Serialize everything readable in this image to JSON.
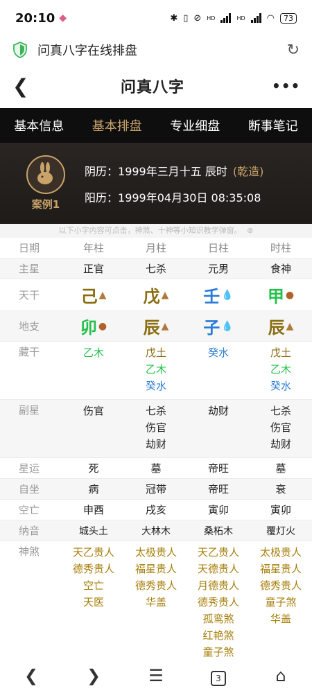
{
  "status": {
    "time": "20:10",
    "battery": "73",
    "hd1": "HD",
    "hd2": "HD"
  },
  "url_bar": {
    "title": "问真八字在线排盘"
  },
  "header": {
    "title": "问真八字",
    "more": "•••"
  },
  "tabs": [
    {
      "label": "基本信息"
    },
    {
      "label": "基本排盘",
      "active": true
    },
    {
      "label": "专业细盘"
    },
    {
      "label": "断事笔记"
    }
  ],
  "profile": {
    "case": "案例1",
    "lunar_label": "阴历：",
    "lunar": "1999年三月十五 辰时",
    "gender_tag": "(乾造)",
    "solar_label": "阳历：",
    "solar": "1999年04月30日 08:35:08"
  },
  "notice": "以下小字内容可点击，神煞、十神等小知识教学弹窗。",
  "grid": {
    "header": {
      "label": "日期",
      "cols": [
        "年柱",
        "月柱",
        "日柱",
        "时柱"
      ]
    },
    "zhuxing": {
      "label": "主星",
      "cols": [
        "正官",
        "七杀",
        "元男",
        "食神"
      ]
    },
    "tiangan": {
      "label": "天干",
      "cols": [
        "己",
        "戊",
        "壬",
        "甲"
      ]
    },
    "dizhi": {
      "label": "地支",
      "cols": [
        "卯",
        "辰",
        "子",
        "辰"
      ]
    },
    "canggan": {
      "label": "藏干",
      "cols": [
        [
          "乙木"
        ],
        [
          "戊土",
          "乙木",
          "癸水"
        ],
        [
          "癸水"
        ],
        [
          "戊土",
          "乙木",
          "癸水"
        ]
      ]
    },
    "fuxing": {
      "label": "副星",
      "cols": [
        [
          "伤官"
        ],
        [
          "七杀",
          "伤官",
          "劫财"
        ],
        [
          "劫财"
        ],
        [
          "七杀",
          "伤官",
          "劫财"
        ]
      ]
    },
    "xingyun": {
      "label": "星运",
      "cols": [
        "死",
        "墓",
        "帝旺",
        "墓"
      ]
    },
    "zizuo": {
      "label": "自坐",
      "cols": [
        "病",
        "冠带",
        "帝旺",
        "衰"
      ]
    },
    "kongwang": {
      "label": "空亡",
      "cols": [
        "申酉",
        "戌亥",
        "寅卯",
        "寅卯"
      ]
    },
    "nayin": {
      "label": "纳音",
      "cols": [
        "城头土",
        "大林木",
        "桑柘木",
        "覆灯火"
      ]
    },
    "shensha": {
      "label": "神煞",
      "cols": [
        [
          "天乙贵人",
          "德秀贵人",
          "空亡",
          "天医"
        ],
        [
          "太极贵人",
          "福星贵人",
          "德秀贵人",
          "华盖"
        ],
        [
          "天乙贵人",
          "天德贵人",
          "月德贵人",
          "德秀贵人",
          "孤鸾煞",
          "红艳煞",
          "童子煞"
        ],
        [
          "太极贵人",
          "福星贵人",
          "德秀贵人",
          "童子煞",
          "华盖"
        ]
      ]
    }
  },
  "bottom_nav": {
    "tab_count": "3"
  },
  "colors": {
    "gold": "#c9a36a",
    "earth": "#8a6d10",
    "water": "#2a7bd6",
    "wood": "#22c04a",
    "shensha": "#a77e0b"
  }
}
